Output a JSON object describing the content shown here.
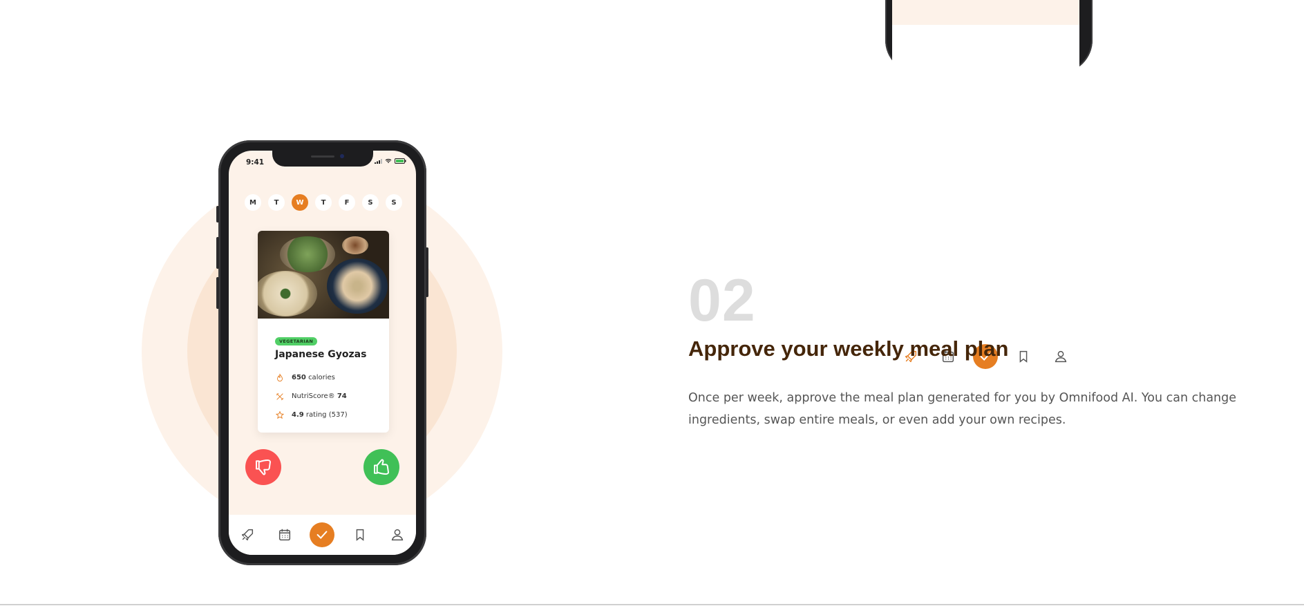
{
  "colors": {
    "accent": "#e67e22",
    "accent_light": "#fdf2e9",
    "accent_mid": "#fae5d3",
    "title_brown": "#45260a",
    "step_number_gray": "#dddddd",
    "tag_green": "#51cf66",
    "reject_red": "#fa5252",
    "approve_green": "#40c057"
  },
  "phone": {
    "status_time": "9:41",
    "days": [
      {
        "label": "M"
      },
      {
        "label": "T"
      },
      {
        "label": "W",
        "active": true
      },
      {
        "label": "T"
      },
      {
        "label": "F"
      },
      {
        "label": "S"
      },
      {
        "label": "S"
      }
    ],
    "card": {
      "tag": "VEGETARIAN",
      "title": "Japanese Gyozas",
      "attributes": [
        {
          "icon": "flame-icon",
          "value": "650",
          "text": "calories"
        },
        {
          "icon": "nutriscore-icon",
          "text": "NutriScore®",
          "value": "74"
        },
        {
          "icon": "star-icon",
          "value": "4.9",
          "text": "rating (537)"
        }
      ]
    },
    "nav_icons": [
      "rocket-icon",
      "calendar-icon",
      "check-icon",
      "bookmark-icon",
      "user-icon"
    ]
  },
  "step": {
    "number": "02",
    "title": "Approve your weekly meal plan",
    "description": "Once per week, approve the meal plan generated for you by Omnifood AI. You can change ingredients, swap entire meals, or even add your own recipes."
  }
}
